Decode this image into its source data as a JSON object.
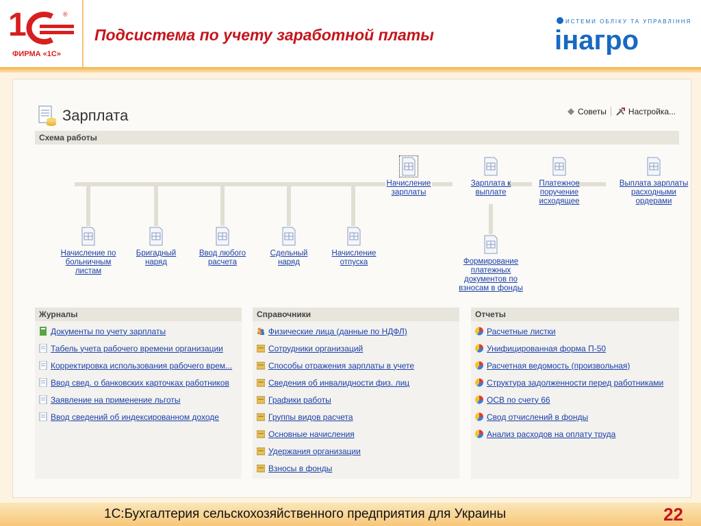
{
  "slide": {
    "logo_text": "ФИРМА «1С»",
    "title": "Подсистема по учету заработной платы",
    "inagro_tagline": "ИСТЕМИ ОБЛІКУ ТА УПРАВЛІННЯ",
    "inagro_name": "інагро",
    "footer": "1С:Бухгалтерия сельскохозяйственного предприятия для Украины",
    "page_number": "22"
  },
  "window": {
    "title": "Зарплата",
    "tips_label": "Советы",
    "settings_label": "Настройка..."
  },
  "scheme": {
    "header": "Схема работы",
    "top_nodes": [
      {
        "label": "Начисление зарплаты"
      },
      {
        "label": "Зарплата к выплате"
      },
      {
        "label": "Платежное поручение исходящее"
      },
      {
        "label": "Выплата зарплаты расходными ордерами"
      }
    ],
    "bottom_nodes": [
      {
        "label": "Начисление по больничным листам"
      },
      {
        "label": "Бригадный наряд"
      },
      {
        "label": "Ввод любого расчета"
      },
      {
        "label": "Сдельный наряд"
      },
      {
        "label": "Начисление отпуска"
      }
    ],
    "fund_node": {
      "label": "Формирование платежных документов по взносам в фонды"
    }
  },
  "journals": {
    "header": "Журналы",
    "items": [
      "Документы по учету зарплаты",
      "Табель учета рабочего времени организации",
      "Корректировка использования рабочего врем...",
      "Ввод свед. о банковских карточках работников",
      "Заявление на применение льготы",
      "Ввод сведений об индексированном доходе"
    ]
  },
  "references": {
    "header": "Справочники",
    "items": [
      "Физические лица (данные по НДФЛ)",
      "Сотрудники организаций",
      "Способы отражения зарплаты в учете",
      "Сведения об инвалидности физ. лиц",
      "Графики работы",
      "Группы видов расчета",
      "Основные начисления",
      "Удержания организации",
      "Взносы в фонды"
    ]
  },
  "reports": {
    "header": "Отчеты",
    "items": [
      "Расчетные листки",
      "Унифицированная форма П-50",
      "Расчетная ведомость (произвольная)",
      "Структура задолженности перед работниками",
      "ОСВ по счету 66",
      "Свод отчислений в фонды",
      "Анализ расходов на оплату труда"
    ]
  }
}
